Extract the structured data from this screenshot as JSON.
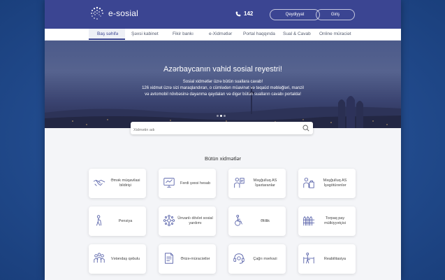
{
  "header": {
    "logo_text": "e-sosial",
    "phone": "142",
    "register_label": "Qeydiyyat",
    "login_label": "Giriş"
  },
  "nav": {
    "items": [
      {
        "label": "Baş səhifə"
      },
      {
        "label": "Şəxsi kabinet"
      },
      {
        "label": "Fikir bankı"
      },
      {
        "label": "e-Xidmətlər"
      },
      {
        "label": "Portal haqqında"
      },
      {
        "label": "Sual & Cavab"
      },
      {
        "label": "Online müraciət"
      }
    ]
  },
  "hero": {
    "title": "Azərbaycanın vahid sosial reyestri!",
    "line1": "Sosial xidmətlər üzrə bütün suallara cavab!",
    "line2": "126 xidmət üzrə sizi maraqlandıran, o cümlədən müavinət və təqaüd məbləğləri, manzil",
    "line3": "və avtomobil növbəsinə dayanma qaydaları və digər bütün sualların cavabı portalda!"
  },
  "search": {
    "placeholder": "Xidmətin adı"
  },
  "services": {
    "title": "Bütün xidmətlər",
    "cards": [
      {
        "label": "Əmək müqavilasi bildirişi",
        "icon": "handshake-icon"
      },
      {
        "label": "Fərdi şəxsi hesab",
        "icon": "monitor-icon"
      },
      {
        "label": "Məşğulluq AS İşaxtaranlar",
        "icon": "job-seeker-icon"
      },
      {
        "label": "Məşğulluq AS İşəgötürənlər",
        "icon": "employer-icon"
      },
      {
        "label": "Pensiya",
        "icon": "elderly-icon"
      },
      {
        "label": "Ünvanlı dövlət sosial yardımı",
        "icon": "network-icon"
      },
      {
        "label": "Əlillik",
        "icon": "wheelchair-icon"
      },
      {
        "label": "Torpaq pay mülkiyyətçisi",
        "icon": "fence-icon"
      },
      {
        "label": "Vətəndaş qəbulu",
        "icon": "citizens-icon"
      },
      {
        "label": "Ərizə-müraciətlər",
        "icon": "document-icon"
      },
      {
        "label": "Çağrı mərkəzi",
        "icon": "headset-icon"
      },
      {
        "label": "Reabilitasiya",
        "icon": "rehab-icon"
      }
    ]
  },
  "colors": {
    "brand": "#3b4592",
    "icon": "#4a55a2"
  }
}
